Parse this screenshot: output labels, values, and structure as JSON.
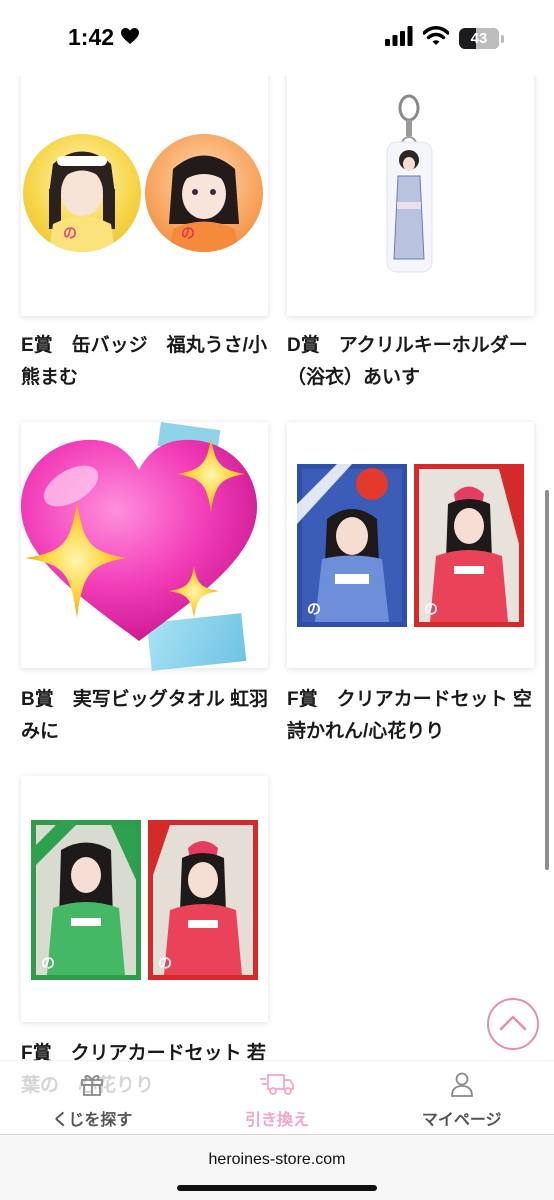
{
  "status_bar": {
    "time": "1:42",
    "battery_level": "43",
    "battery_fraction": 0.43
  },
  "products": [
    {
      "title": "E賞　缶バッジ　福丸うさ/小熊まむ",
      "image": "two-round-can-badges"
    },
    {
      "title": "D賞　アクリルキーホルダー（浴衣）あいす",
      "image": "acrylic-keyholder-yukata"
    },
    {
      "title": "B賞　実写ビッグタオル 虹羽みに",
      "image": "big-towel-covered-by-sparkling-heart-emoji"
    },
    {
      "title": "F賞　クリアカードセット 空詩かれん/心花りり",
      "image": "clear-card-set-blue-red"
    },
    {
      "title": "F賞　クリアカードセット 若葉の　心花りり",
      "image": "clear-card-set-green-red"
    }
  ],
  "tab_bar": {
    "items": [
      {
        "label": "くじを探す",
        "icon": "gift-icon",
        "active": false
      },
      {
        "label": "引き換え",
        "icon": "delivery-truck-icon",
        "active": true
      },
      {
        "label": "マイページ",
        "icon": "person-icon",
        "active": false
      }
    ]
  },
  "browser": {
    "url": "heroines-store.com"
  },
  "colors": {
    "accent_pink": "#f3a7c6",
    "scroll_button_border": "#e28fb3",
    "text": "#1a1a1a"
  }
}
